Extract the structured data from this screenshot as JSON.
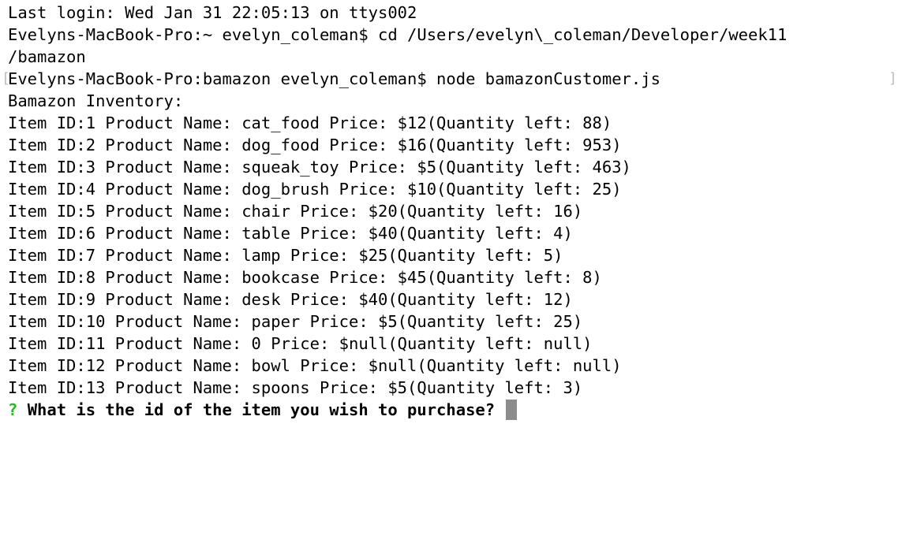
{
  "terminal": {
    "lines": [
      "Last login: Wed Jan 31 22:05:13 on ttys002",
      "Evelyns-MacBook-Pro:~ evelyn_coleman$ cd /Users/evelyn\\_coleman/Developer/week11",
      "/bamazon",
      "Evelyns-MacBook-Pro:bamazon evelyn_coleman$ node bamazonCustomer.js",
      "Bamazon Inventory:",
      "Item ID:1 Product Name: cat_food Price: $12(Quantity left: 88)",
      "Item ID:2 Product Name: dog_food Price: $16(Quantity left: 953)",
      "Item ID:3 Product Name: squeak_toy Price: $5(Quantity left: 463)",
      "Item ID:4 Product Name: dog_brush Price: $10(Quantity left: 25)",
      "Item ID:5 Product Name: chair Price: $20(Quantity left: 16)",
      "Item ID:6 Product Name: table Price: $40(Quantity left: 4)",
      "Item ID:7 Product Name: lamp Price: $25(Quantity left: 5)",
      "Item ID:8 Product Name: bookcase Price: $45(Quantity left: 8)",
      "Item ID:9 Product Name: desk Price: $40(Quantity left: 12)",
      "Item ID:10 Product Name: paper Price: $5(Quantity left: 25)",
      "Item ID:11 Product Name: 0 Price: $null(Quantity left: null)",
      "Item ID:12 Product Name: bowl Price: $null(Quantity left: null)",
      "Item ID:13 Product Name: spoons Price: $5(Quantity left: 3)"
    ],
    "prompt": {
      "marker": "?",
      "question": "What is the id of the item you wish to purchase?"
    },
    "colors": {
      "background": "#ffffff",
      "text": "#000000",
      "prompt_marker": "#2ab52a",
      "cursor": "#8c8c8c"
    }
  }
}
